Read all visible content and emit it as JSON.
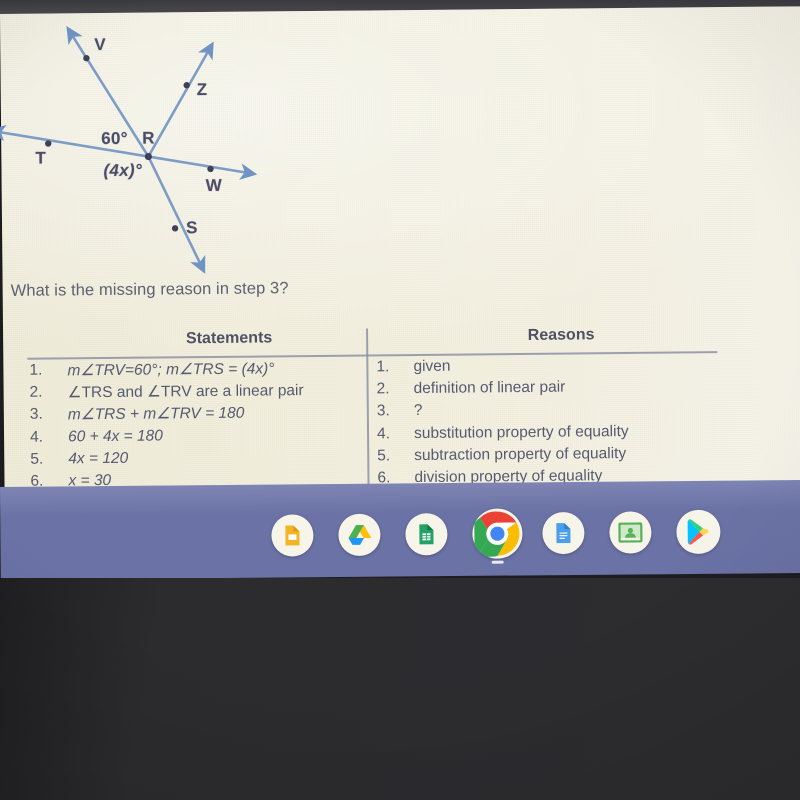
{
  "device": {
    "platform_shelf_color": "#6b73a6",
    "bezel_color": "#46464a",
    "paper_color": "#f2efdd"
  },
  "figure": {
    "name": "angle-diagram",
    "vertex_label": "R",
    "labels": [
      {
        "id": "V",
        "text": "V"
      },
      {
        "id": "Z",
        "text": "Z"
      },
      {
        "id": "T",
        "text": "T"
      },
      {
        "id": "R",
        "text": "R"
      },
      {
        "id": "W",
        "text": "W"
      },
      {
        "id": "S",
        "text": "S"
      }
    ],
    "angle_measures": [
      {
        "id": "angle-trv",
        "text": "60°"
      },
      {
        "id": "angle-trs",
        "text": "(4x)°"
      }
    ],
    "line_color": "#7394bd"
  },
  "question": {
    "text": "What is the missing reason in step 3?"
  },
  "table": {
    "headers": {
      "statements": "Statements",
      "reasons": "Reasons"
    },
    "rows": [
      {
        "num": "1.",
        "statement": "m∠TRV=60°; m∠TRS = (4x)°",
        "reason_num": "1.",
        "reason": "given"
      },
      {
        "num": "2.",
        "statement": "∠TRS and ∠TRV are a linear pair",
        "reason_num": "2.",
        "reason": "definition of linear pair"
      },
      {
        "num": "3.",
        "statement": "m∠TRS + m∠TRV = 180",
        "reason_num": "3.",
        "reason": "?"
      },
      {
        "num": "4.",
        "statement": "60 + 4x = 180",
        "reason_num": "4.",
        "reason": "substitution property of equality"
      },
      {
        "num": "5.",
        "statement": "4x = 120",
        "reason_num": "5.",
        "reason": "subtraction property of equality"
      },
      {
        "num": "6.",
        "statement": "x = 30",
        "reason_num": "6.",
        "reason": "division property of equality"
      }
    ]
  },
  "shelf": {
    "icons": [
      {
        "name": "google-slides-icon",
        "label": "Google Slides"
      },
      {
        "name": "google-drive-icon",
        "label": "Google Drive"
      },
      {
        "name": "google-sheets-icon",
        "label": "Google Sheets"
      },
      {
        "name": "google-chrome-icon",
        "label": "Chrome"
      },
      {
        "name": "google-docs-icon",
        "label": "Google Docs"
      },
      {
        "name": "google-classroom-icon",
        "label": "Google Classroom"
      },
      {
        "name": "google-play-store-icon",
        "label": "Play Store"
      }
    ]
  }
}
